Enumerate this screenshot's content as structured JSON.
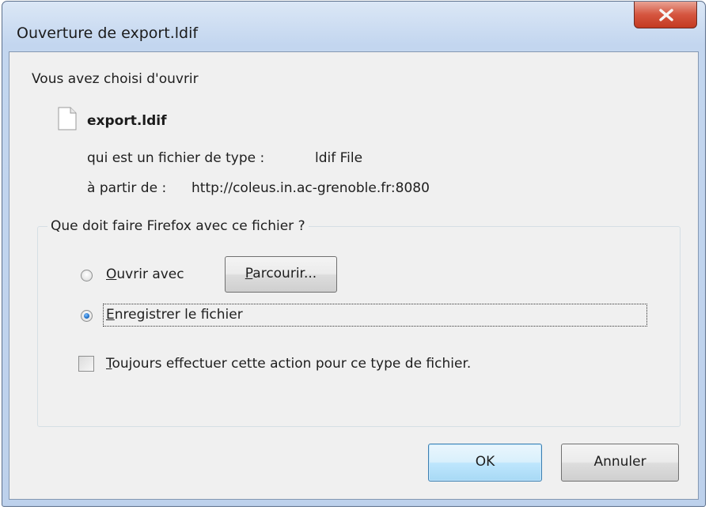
{
  "window": {
    "title": "Ouverture de export.ldif",
    "close_icon": "close-icon"
  },
  "intro": "Vous avez choisi d'ouvrir",
  "file": {
    "icon": "file-icon",
    "name": "export.ldif",
    "type_label": "qui est un fichier de type :",
    "type_value": "ldif File",
    "from_label": "à partir de :",
    "from_value": "http://coleus.in.ac-grenoble.fr:8080"
  },
  "action_group": {
    "legend": "Que doit faire Firefox avec ce fichier ?",
    "open_with": {
      "label_key": "O",
      "label_rest": "uvrir avec",
      "checked": false
    },
    "browse_button": {
      "label_key": "P",
      "label_rest": "arcourir..."
    },
    "save_file": {
      "label_key": "E",
      "label_rest": "nregistrer le fichier",
      "checked": true
    },
    "always": {
      "label_key": "T",
      "label_rest": "oujours effectuer cette action pour ce type de fichier.",
      "checked": false
    }
  },
  "buttons": {
    "ok": "OK",
    "cancel": "Annuler"
  }
}
